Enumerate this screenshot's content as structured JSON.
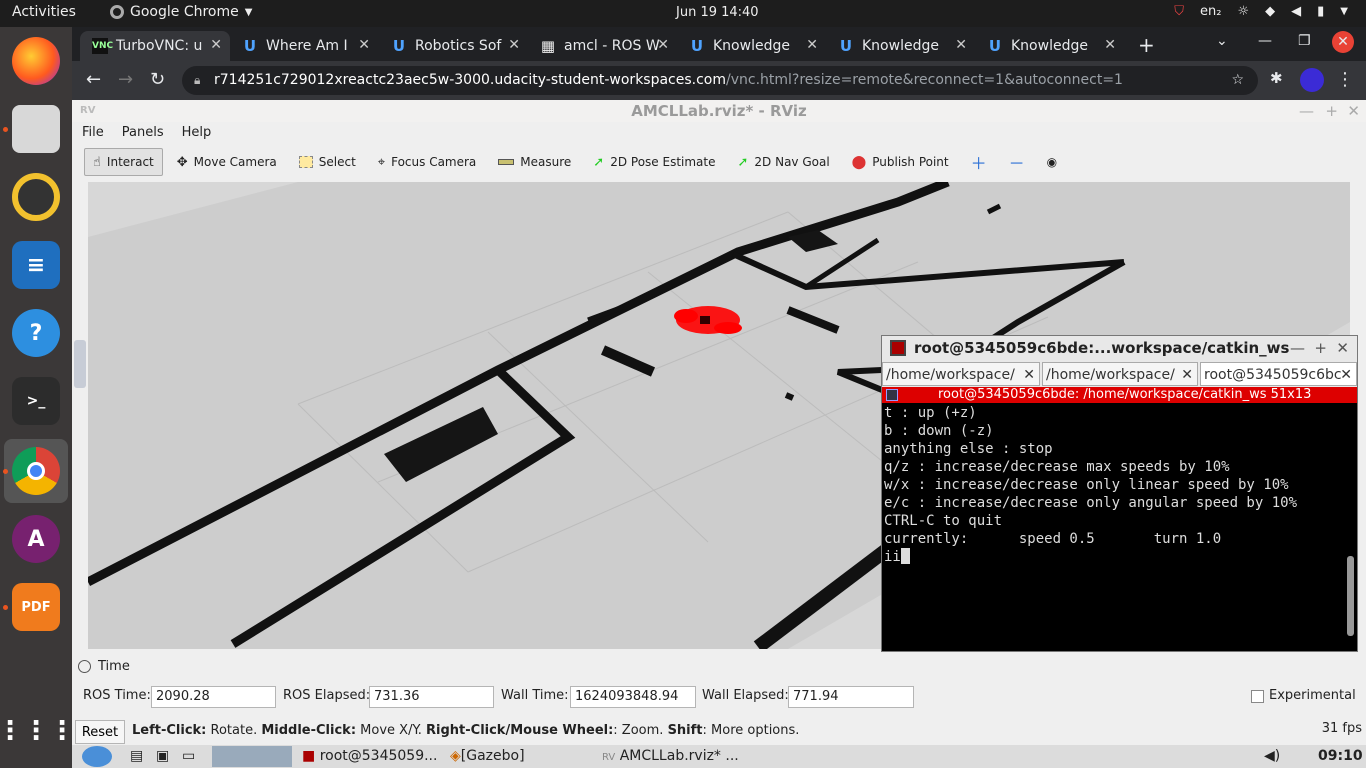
{
  "topbar": {
    "activities": "Activities",
    "app_name": "Google Chrome",
    "clock": "Jun 19  14:40",
    "lang": "en₂"
  },
  "chrome": {
    "tabs": [
      {
        "label": "TurboVNC: u"
      },
      {
        "label": "Where Am I"
      },
      {
        "label": "Robotics Sof"
      },
      {
        "label": "amcl - ROS W"
      },
      {
        "label": "Knowledge"
      },
      {
        "label": "Knowledge"
      },
      {
        "label": "Knowledge"
      }
    ],
    "url_host": "r714251c729012xreactc23aec5w-3000.udacity-student-workspaces.com",
    "url_path": "/vnc.html?resize=remote&reconnect=1&autoconnect=1"
  },
  "rviz": {
    "title": "AMCLLab.rviz* - RViz",
    "menu": [
      "File",
      "Panels",
      "Help"
    ],
    "tools": [
      {
        "label": "Interact"
      },
      {
        "label": "Move Camera"
      },
      {
        "label": "Select"
      },
      {
        "label": "Focus Camera"
      },
      {
        "label": "Measure"
      },
      {
        "label": "2D Pose Estimate"
      },
      {
        "label": "2D Nav Goal"
      },
      {
        "label": "Publish Point"
      }
    ],
    "time_panel": {
      "header": "Time",
      "ros_time_label": "ROS Time:",
      "ros_time": "2090.28",
      "ros_elapsed_label": "ROS Elapsed:",
      "ros_elapsed": "731.36",
      "wall_time_label": "Wall Time:",
      "wall_time": "1624093848.94",
      "wall_elapsed_label": "Wall Elapsed:",
      "wall_elapsed": "771.94",
      "experimental": "Experimental"
    },
    "status": {
      "reset": "Reset",
      "hint_b1": "Left-Click:",
      "hint_t1": " Rotate. ",
      "hint_b2": "Middle-Click:",
      "hint_t2": " Move X/Y. ",
      "hint_b3": "Right-Click/Mouse Wheel:",
      "hint_t3": ": Zoom. ",
      "hint_b4": "Shift",
      "hint_t4": ": More options.",
      "fps": "31 fps"
    }
  },
  "terminal": {
    "title": "root@5345059c6bde:...workspace/catkin_ws",
    "tabs": [
      "/home/workspace/",
      "/home/workspace/",
      "root@5345059c6bc"
    ],
    "status_bar": "root@5345059c6bde: /home/workspace/catkin_ws 51x13",
    "lines": [
      "t : up (+z)",
      "b : down (-z)",
      "",
      "anything else : stop",
      "",
      "q/z : increase/decrease max speeds by 10%",
      "w/x : increase/decrease only linear speed by 10%",
      "e/c : increase/decrease only angular speed by 10%",
      "",
      "CTRL-C to quit",
      "",
      "currently:      speed 0.5       turn 1.0",
      "ii"
    ]
  },
  "taskbar": {
    "items": [
      "root@5345059...",
      "[Gazebo]",
      "AMCLLab.rviz* ..."
    ],
    "clock": "09:10"
  }
}
